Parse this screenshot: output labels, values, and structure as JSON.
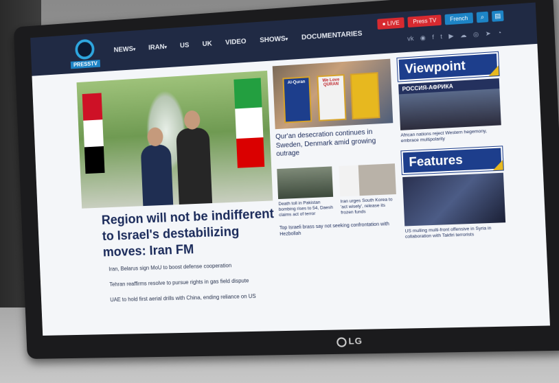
{
  "site": {
    "logo_text": "PRESSTV"
  },
  "nav": [
    {
      "label": "NEWS",
      "caret": true
    },
    {
      "label": "IRAN",
      "caret": true
    },
    {
      "label": "US",
      "caret": false
    },
    {
      "label": "UK",
      "caret": false
    },
    {
      "label": "VIDEO",
      "caret": false
    },
    {
      "label": "SHOWS",
      "caret": true
    },
    {
      "label": "DOCUMENTARIES",
      "caret": false
    }
  ],
  "actions": {
    "live": "● LIVE",
    "presstv": "Press TV",
    "language": "French"
  },
  "hero": {
    "title": "Region will not be indifferent to Israel's destabilizing moves: Iran FM"
  },
  "sub_links": [
    "Iran, Belarus sign MoU to boost defense cooperation",
    "Tehran reaffirms resolve to pursue rights in gas field dispute",
    "UAE to hold first aerial drills with China, ending reliance on US"
  ],
  "middle": {
    "poster_labels": [
      "Al-Quran",
      "We Love QURAN"
    ],
    "main_caption": "Qur'an desecration continues in Sweden, Denmark amid growing outrage",
    "thumbs": [
      {
        "caption": "Death toll in Pakistan bombing rises to 54, Daesh claims act of terror"
      },
      {
        "caption": "Iran urges South Korea to 'act wisely', release its frozen funds"
      }
    ],
    "bottom_link": "Top Israeli brass say not seeking confrontation with Hezbollah"
  },
  "viewpoint": {
    "badge": "Viewpoint",
    "image_text": "РОССИЯ-АФРИКА",
    "caption": "African nations reject Western hegemony, embrace multipolarity"
  },
  "features": {
    "badge": "Features",
    "caption": "US mulling multi-front offensive in Syria in collaboration with Takfiri terrorists"
  },
  "monitor": {
    "brand": "LG"
  },
  "colors": {
    "header_bg": "#202a44",
    "accent_blue": "#1d84c6",
    "live_red": "#d72a30",
    "badge_navy": "#1d3e8c",
    "badge_corner": "#e7b81f",
    "headline": "#1a2a5a"
  }
}
